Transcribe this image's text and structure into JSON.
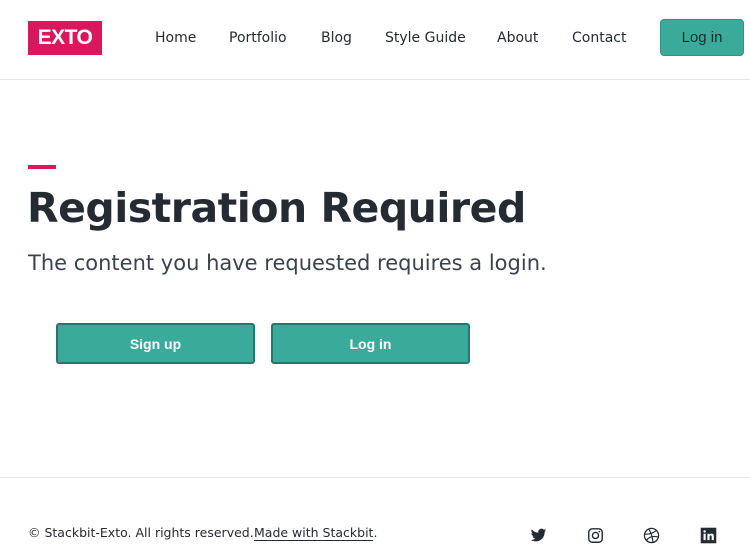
{
  "brand": {
    "logo_text": "EXTO",
    "accent_color": "#d9175d",
    "button_color": "#3aab9a"
  },
  "nav": {
    "items": [
      {
        "label": "Home"
      },
      {
        "label": "Portfolio"
      },
      {
        "label": "Blog"
      },
      {
        "label": "Style Guide"
      },
      {
        "label": "About"
      },
      {
        "label": "Contact"
      }
    ],
    "login_label": "Log in"
  },
  "main": {
    "title": "Registration Required",
    "subtitle": "The content you have requested requires a login.",
    "signup_label": "Sign up",
    "login_label": "Log in"
  },
  "footer": {
    "copyright": "© Stackbit-Exto. All rights reserved.",
    "made_with_link": "Made with Stackbit",
    "made_with_suffix": ".",
    "social": [
      {
        "icon": "twitter-icon"
      },
      {
        "icon": "instagram-icon"
      },
      {
        "icon": "dribbble-icon"
      },
      {
        "icon": "linkedin-icon"
      }
    ]
  }
}
